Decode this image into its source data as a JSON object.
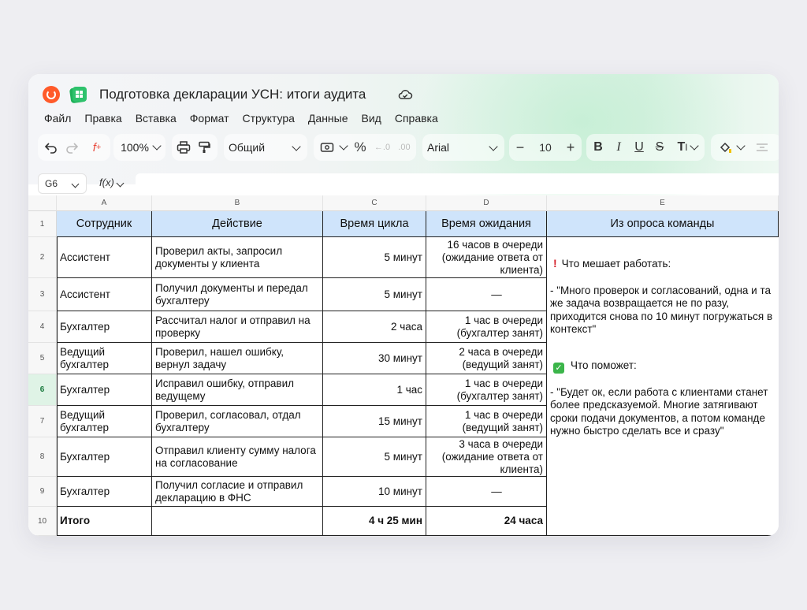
{
  "app": {
    "title": "Подготовка декларации УСН: итоги аудита",
    "brand_color": "#ff5a2a",
    "tables_color": "#1fb25a"
  },
  "menu": [
    "Файл",
    "Правка",
    "Вставка",
    "Формат",
    "Структура",
    "Данные",
    "Вид",
    "Справка"
  ],
  "toolbar": {
    "zoom": "100%",
    "number_format": "Общий",
    "percent": "%",
    "font": "Arial",
    "font_size": "10",
    "minus": "−",
    "plus": "+",
    "bold": "B",
    "italic": "I",
    "underline": "U",
    "strike": "S",
    "text_color": "T"
  },
  "formula_bar": {
    "cell_ref": "G6",
    "fx_label": "f(x)",
    "value": ""
  },
  "columns": [
    "A",
    "B",
    "C",
    "D",
    "E"
  ],
  "rows": [
    "1",
    "2",
    "3",
    "4",
    "5",
    "6",
    "7",
    "8",
    "9",
    "10"
  ],
  "active_row": "6",
  "table": {
    "headers": [
      "Сотрудник",
      "Действие",
      "Время цикла",
      "Время ожидания",
      "Из опроса команды"
    ],
    "body": [
      [
        "Ассистент",
        "Проверил акты, запросил документы у клиента",
        "5 минут",
        "16 часов в очереди (ожидание ответа от клиента)"
      ],
      [
        "Ассистент",
        "Получил документы и передал бухгалтеру",
        "5 минут",
        "—"
      ],
      [
        "Бухгалтер",
        "Рассчитал налог и отправил на проверку",
        "2 часа",
        "1 час в очереди (бухгалтер занят)"
      ],
      [
        "Ведущий бухгалтер",
        "Проверил, нашел ошибку, вернул задачу",
        "30 минут",
        "2 часа в очереди (ведущий занят)"
      ],
      [
        "Бухгалтер",
        "Исправил ошибку, отправил ведущему",
        "1 час",
        "1 час в очереди (бухгалтер занят)"
      ],
      [
        "Ведущий бухгалтер",
        "Проверил, согласовал, отдал бухгалтеру",
        "15 минут",
        "1 час в очереди (ведущий занят)"
      ],
      [
        "Бухгалтер",
        "Отправил клиенту сумму налога на согласование",
        "5 минут",
        "3 часа в очереди (ожидание ответа от клиента)"
      ],
      [
        "Бухгалтер",
        "Получил согласие и отправил декларацию в ФНС",
        "10 минут",
        "—"
      ]
    ],
    "total": [
      "Итого",
      "",
      "4 ч 25 мин",
      "24 часа"
    ],
    "survey": {
      "problem_mark": "!",
      "problem_title": "Что мешает работать:",
      "problem_text": "- \"Много проверок и согласований, одна и та же задача возвращается не по разу, приходится снова по 10 минут погружаться в контекст\"",
      "help_mark": "✓",
      "help_title": "Что поможет:",
      "help_text": "- \"Будет ок, если работа с клиентами станет более предсказуемой. Многие затягивают сроки подачи документов, а потом команде нужно быстро сделать все и сразу\""
    }
  },
  "colors": {
    "header_fill": "#cfe4fb",
    "active_row": "#dff3e6",
    "alert": "#d4202a",
    "ok": "#3bb54a"
  }
}
